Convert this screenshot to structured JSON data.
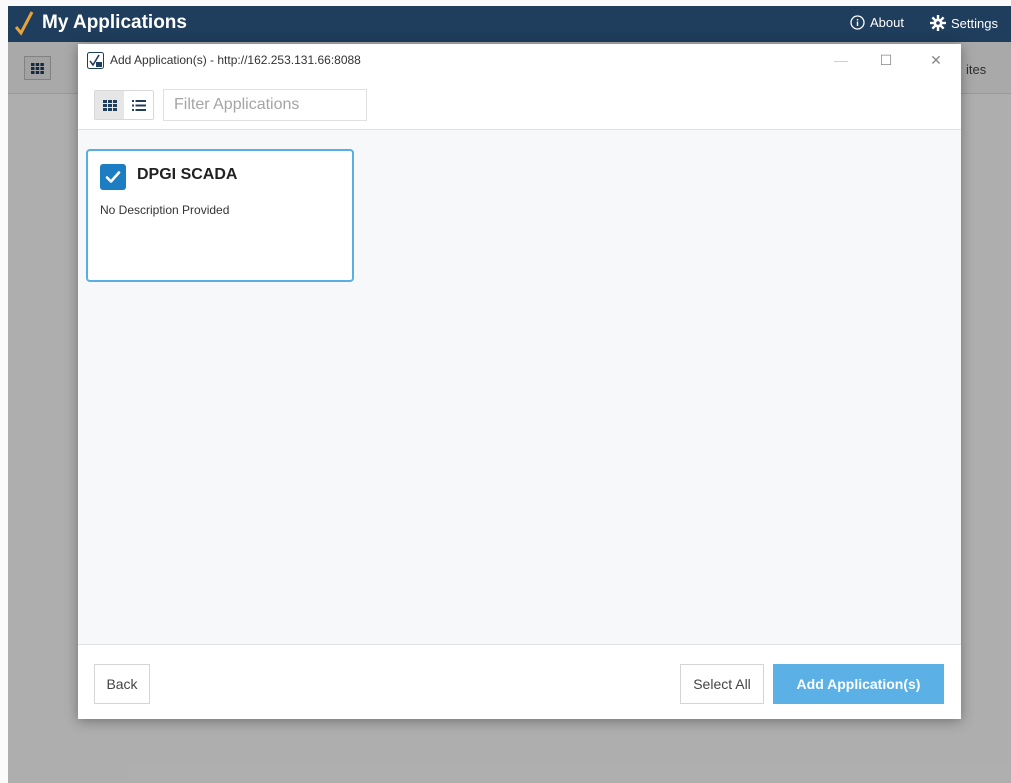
{
  "app": {
    "title": "My Applications",
    "about_label": "About",
    "settings_label": "Settings",
    "favorites_label": "ites"
  },
  "dialog": {
    "title": "Add Application(s) - http://162.253.131.66:8088",
    "filter_placeholder": "Filter Applications",
    "minimize_glyph": "—",
    "maximize_glyph": "☐",
    "close_glyph": "✕"
  },
  "applications": [
    {
      "name": "DPGI SCADA",
      "description": "No Description Provided",
      "selected": true
    }
  ],
  "footer": {
    "back_label": "Back",
    "select_all_label": "Select All",
    "add_label": "Add Application(s)"
  },
  "colors": {
    "header_bg": "#1f3d5c",
    "accent": "#1d7dc2",
    "primary_button": "#5bb1e6",
    "card_border": "#58aee5"
  }
}
